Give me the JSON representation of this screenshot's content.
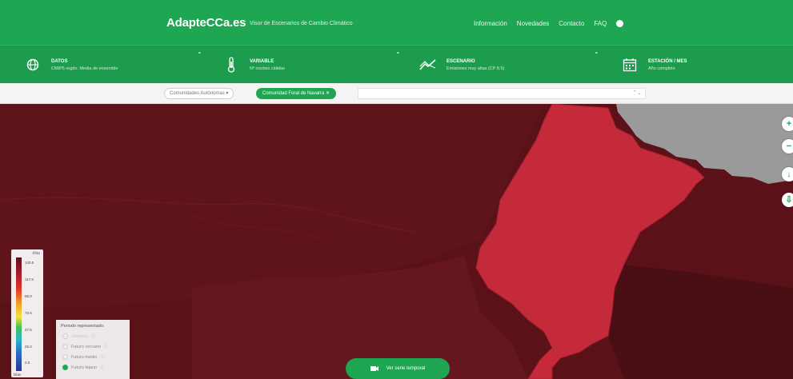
{
  "header": {
    "brand": "AdapteCCa.es",
    "tagline": "Visor de Escenarios de Cambio Climático",
    "nav": [
      "Información",
      "Novedades",
      "Contacto",
      "FAQ"
    ],
    "help_icon": "?"
  },
  "selectors": [
    {
      "title": "DATOS",
      "subtitle": "CMIP5 regdo. Media de ensemble",
      "icon": "globe-icon"
    },
    {
      "title": "VARIABLE",
      "subtitle": "Nº noches cálidas",
      "icon": "thermometer-icon"
    },
    {
      "title": "ESCENARIO",
      "subtitle": "Emisiones muy altas (CP 8.5)",
      "icon": "trend-icon"
    },
    {
      "title": "ESTACIÓN / MES",
      "subtitle": "Año completo",
      "icon": "calendar-icon"
    }
  ],
  "filter": {
    "region_dropdown": "Comunidades Autónomas ▾",
    "region_chip": "Comunidad Foral de Navarra ✕",
    "search_arrows": "⌃⌄"
  },
  "map_controls": [
    "+",
    "−",
    "↓",
    "⇩"
  ],
  "legend": {
    "unit": "días",
    "ticks": [
      "140.0",
      "117.5",
      "95.0",
      "72.5",
      "47.5",
      "25.0",
      "2.5"
    ],
    "bottom_label": "Días"
  },
  "period_panel": {
    "title": "Periodo representado:",
    "options": [
      {
        "label": "Histórico",
        "selected": false,
        "disabled": true
      },
      {
        "label": "Futuro cercano",
        "selected": false
      },
      {
        "label": "Futuro medio",
        "selected": false
      },
      {
        "label": "Futuro lejano",
        "selected": true
      }
    ]
  },
  "series_button": "Ver serie temporal",
  "colors": {
    "brand_green": "#1fa653",
    "map_dark": "#5a1218",
    "map_region": "#c42a3a",
    "map_gray": "#9a9a9a"
  }
}
